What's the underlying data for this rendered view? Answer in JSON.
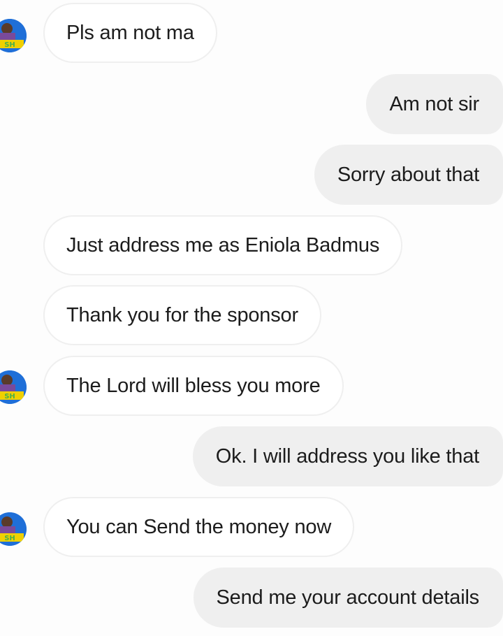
{
  "conversation": {
    "messages": [
      {
        "sender": "contact",
        "text": "Pls am not ma",
        "avatar": true
      },
      {
        "sender": "me",
        "text": "Am not sir"
      },
      {
        "sender": "me",
        "text": "Sorry about that"
      },
      {
        "sender": "contact",
        "text": "Just address me as Eniola Badmus",
        "avatar": false
      },
      {
        "sender": "contact",
        "text": "Thank you for the sponsor",
        "avatar": false
      },
      {
        "sender": "contact",
        "text": "The Lord will bless you more",
        "avatar": true
      },
      {
        "sender": "me",
        "text": "Ok. I will address you like that"
      },
      {
        "sender": "contact",
        "text": "You can Send the money now",
        "avatar": true
      },
      {
        "sender": "me",
        "text": "Send me your account details"
      }
    ],
    "avatar": {
      "icon": "profile-avatar-icon",
      "partial_text": "SH",
      "colors": {
        "ring": "#1f6fd8",
        "badge": "#f0d000",
        "text": "#4ab04a"
      }
    }
  },
  "colors": {
    "incoming_bubble": "#ffffff",
    "incoming_border": "#efefef",
    "outgoing_bubble": "#efefef",
    "text": "#1c1c1c"
  }
}
